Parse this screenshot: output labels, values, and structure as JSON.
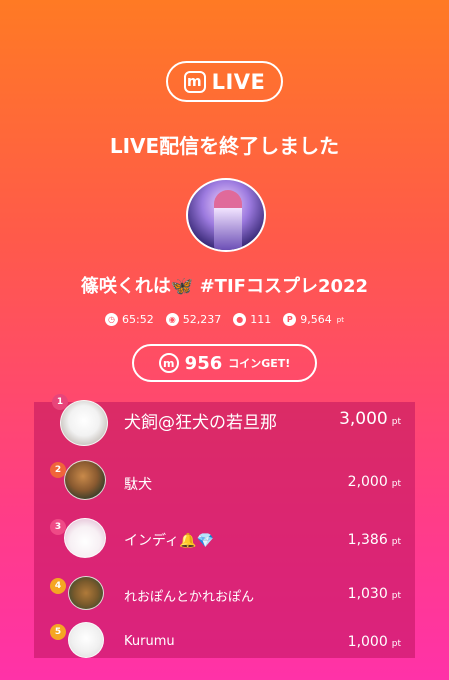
{
  "header": {
    "badge_label": "LIVE",
    "logo_letter": "m"
  },
  "end_message": "LIVE配信を終了しました",
  "streamer_name": "篠咲くれは🦋 #TIFコスプレ2022",
  "stats": {
    "duration": "65:52",
    "viewers": "52,237",
    "comments": "111",
    "points": "9,564",
    "points_unit": "pt"
  },
  "coins": {
    "amount": "956",
    "label": "コインGET!"
  },
  "colors": {
    "rank1": "#e8457a",
    "rank2": "#f0653a",
    "rank3": "#ef4a86",
    "rank4": "#f5a623",
    "rank5": "#f5a623"
  },
  "ranking": [
    {
      "rank": "1",
      "name": "犬飼@狂犬の若旦那",
      "points": "3,000",
      "unit": "pt"
    },
    {
      "rank": "2",
      "name": "駄犬",
      "points": "2,000",
      "unit": "pt"
    },
    {
      "rank": "3",
      "name": "インディ🔔💎",
      "points": "1,386",
      "unit": "pt"
    },
    {
      "rank": "4",
      "name": "れおぽんとかれおぽん",
      "points": "1,030",
      "unit": "pt"
    },
    {
      "rank": "5",
      "name": "Kurumu",
      "points": "1,000",
      "unit": "pt"
    }
  ]
}
